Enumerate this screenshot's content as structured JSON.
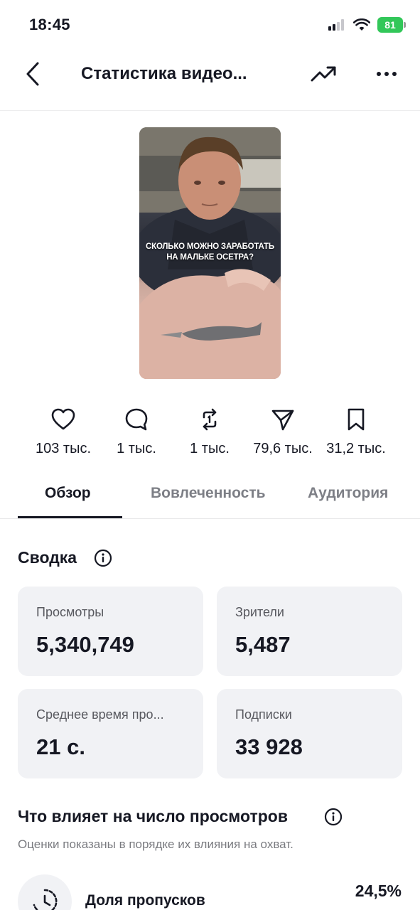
{
  "status_bar": {
    "time": "18:45",
    "battery": "81"
  },
  "header": {
    "title": "Статистика видео..."
  },
  "video": {
    "caption_line1": "СКОЛЬКО МОЖНО ЗАРАБОТАТЬ",
    "caption_line2": "НА МАЛЬКЕ ОСЕТРА?"
  },
  "stats": {
    "likes": "103 тыс.",
    "comments": "1 тыс.",
    "reposts": "1 тыс.",
    "shares": "79,6 тыс.",
    "saves": "31,2 тыс."
  },
  "tabs": [
    {
      "label": "Обзор"
    },
    {
      "label": "Вовлеченность"
    },
    {
      "label": "Аудитория"
    }
  ],
  "summary": {
    "title": "Сводка",
    "cards": [
      {
        "label": "Просмотры",
        "value": "5,340,749"
      },
      {
        "label": "Зрители",
        "value": "5,487"
      },
      {
        "label": "Среднее время про...",
        "value": "21 с."
      },
      {
        "label": "Подписки",
        "value": "33 928"
      }
    ]
  },
  "factors": {
    "title": "Что влияет на число просмотров",
    "subtitle": "Оценки показаны в порядке их влияния на охват.",
    "items": [
      {
        "label": "Доля пропусков",
        "value": "24,5%"
      }
    ]
  },
  "colors": {
    "text": "#161823",
    "muted": "#7d7f86",
    "card_bg": "#f1f2f5",
    "battery": "#32c759"
  }
}
